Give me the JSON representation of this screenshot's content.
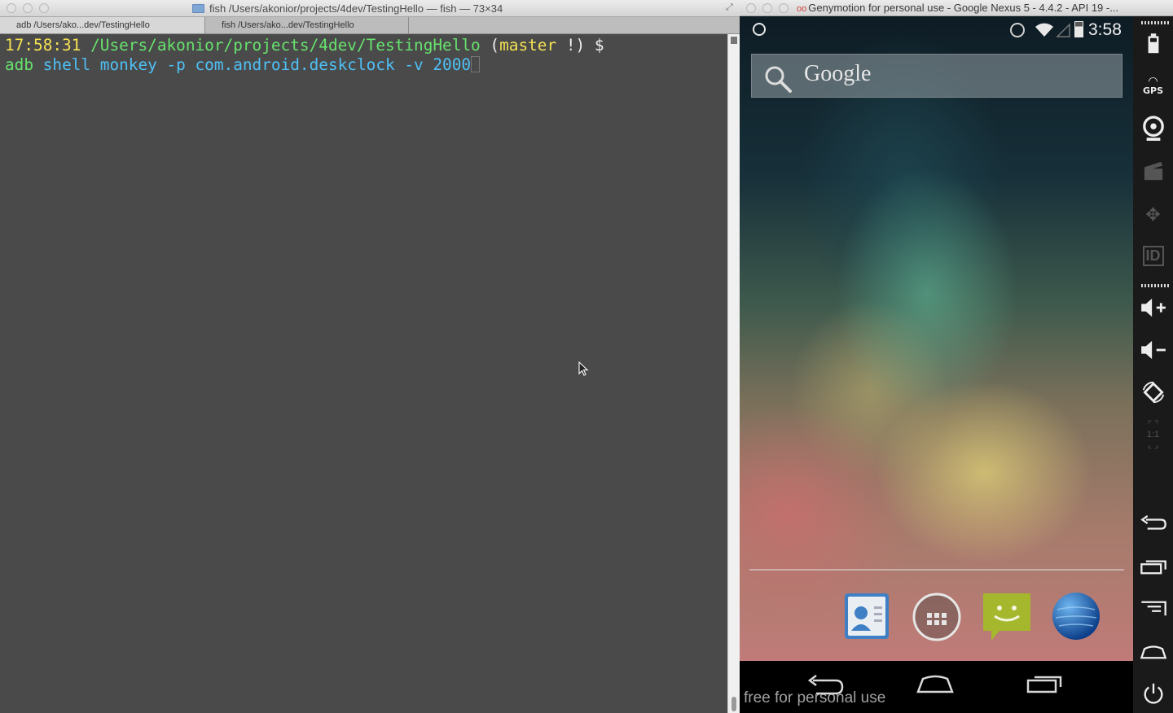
{
  "terminal": {
    "window_title": "fish  /Users/akonior/projects/4dev/TestingHello — fish — 73×34",
    "tabs": [
      {
        "label": "adb  /Users/ako...dev/TestingHello"
      },
      {
        "label": "fish  /Users/ako...dev/TestingHello"
      }
    ],
    "prompt": {
      "time": "17:58:31",
      "path": "/Users/akonior/projects/4dev/TestingHello",
      "branch_open": "(",
      "branch": "master",
      "branch_status": " !",
      "branch_close": ")",
      "symbol": "$"
    },
    "command": {
      "program": "adb",
      "args": "shell monkey -p com.android.deskclock -v 2000"
    }
  },
  "genymotion": {
    "window_title": "Genymotion for personal use - Google Nexus 5 - 4.4.2 - API 19 -...",
    "status_bar": {
      "time": "3:58"
    },
    "search": {
      "label": "Google"
    },
    "dock": [
      {
        "name": "Contacts"
      },
      {
        "name": "Apps"
      },
      {
        "name": "Messaging"
      },
      {
        "name": "Browser"
      }
    ],
    "watermark": "free for personal use",
    "sidebar": {
      "gps_label": "GPS",
      "id_label": "ID",
      "scale_label": "1:1"
    }
  }
}
